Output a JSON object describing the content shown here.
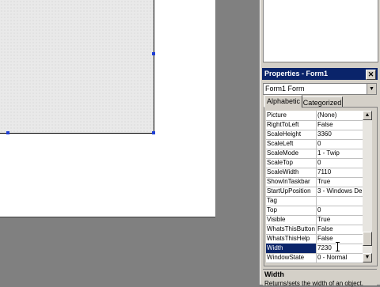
{
  "properties": {
    "title": "Properties - Form1",
    "close": "✕",
    "object_combo": {
      "value": "Form1 Form",
      "arrow": "▼"
    },
    "tabs": [
      {
        "label": "Alphabetic",
        "selected": true
      },
      {
        "label": "Categorized",
        "selected": false
      }
    ],
    "rows": [
      {
        "name": "Picture",
        "value": "(None)"
      },
      {
        "name": "RightToLeft",
        "value": "False"
      },
      {
        "name": "ScaleHeight",
        "value": "3360"
      },
      {
        "name": "ScaleLeft",
        "value": "0"
      },
      {
        "name": "ScaleMode",
        "value": "1 - Twip"
      },
      {
        "name": "ScaleTop",
        "value": "0"
      },
      {
        "name": "ScaleWidth",
        "value": "7110"
      },
      {
        "name": "ShowInTaskbar",
        "value": "True"
      },
      {
        "name": "StartUpPosition",
        "value": "3 - Windows De"
      },
      {
        "name": "Tag",
        "value": ""
      },
      {
        "name": "Top",
        "value": "0"
      },
      {
        "name": "Visible",
        "value": "True"
      },
      {
        "name": "WhatsThisButton",
        "value": "False"
      },
      {
        "name": "WhatsThisHelp",
        "value": "False"
      },
      {
        "name": "Width",
        "value": "7230",
        "selected": true
      },
      {
        "name": "WindowState",
        "value": "0 - Normal"
      }
    ],
    "scroll": {
      "up": "▲",
      "down": "▼",
      "thumb_position": 0.93
    },
    "description": {
      "title": "Width",
      "text": "Returns/sets the width of an object."
    }
  },
  "colors": {
    "title_bar": "#0a246a",
    "selection_handle": "#1f3fd6",
    "background": "#808080"
  }
}
